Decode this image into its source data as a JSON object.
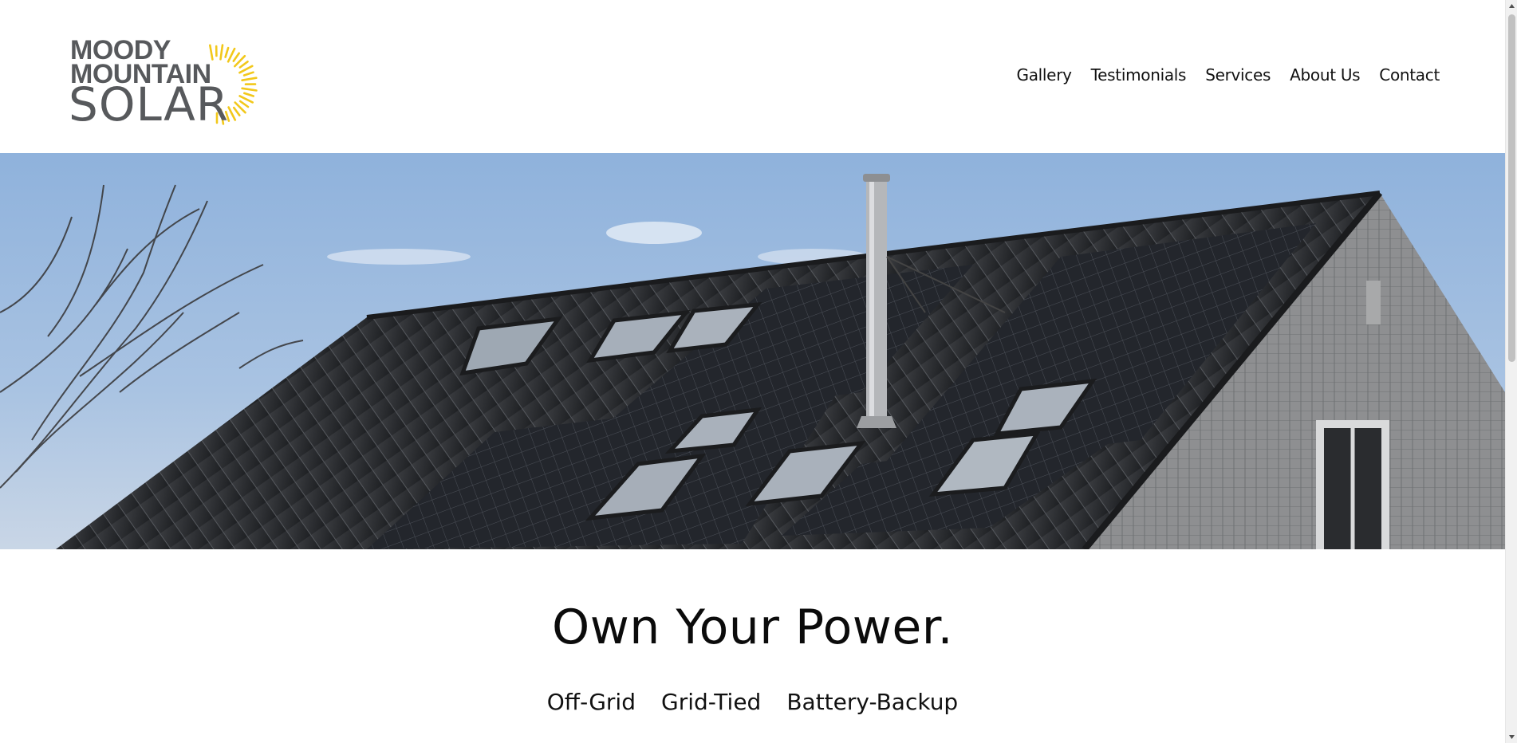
{
  "brand": {
    "line1": "MOODY",
    "line2": "MOUNTAIN",
    "line3": "SOLAR",
    "text_color": "#57595c",
    "sun_color": "#f2c81b",
    "logo_icon": "sun-rays-icon"
  },
  "nav": {
    "items": [
      {
        "label": "Gallery"
      },
      {
        "label": "Testimonials"
      },
      {
        "label": "Services"
      },
      {
        "label": "About Us"
      },
      {
        "label": "Contact"
      }
    ]
  },
  "hero": {
    "image": "house-roof-solar-panels-photo",
    "sky_color": "#9fbde0",
    "roof_color": "#2e3033"
  },
  "main": {
    "headline": "Own Your Power.",
    "tags": [
      "Off-Grid",
      "Grid-Tied",
      "Battery-Backup"
    ]
  },
  "scrollbar": {
    "thumb_color": "#c1c1c1"
  }
}
